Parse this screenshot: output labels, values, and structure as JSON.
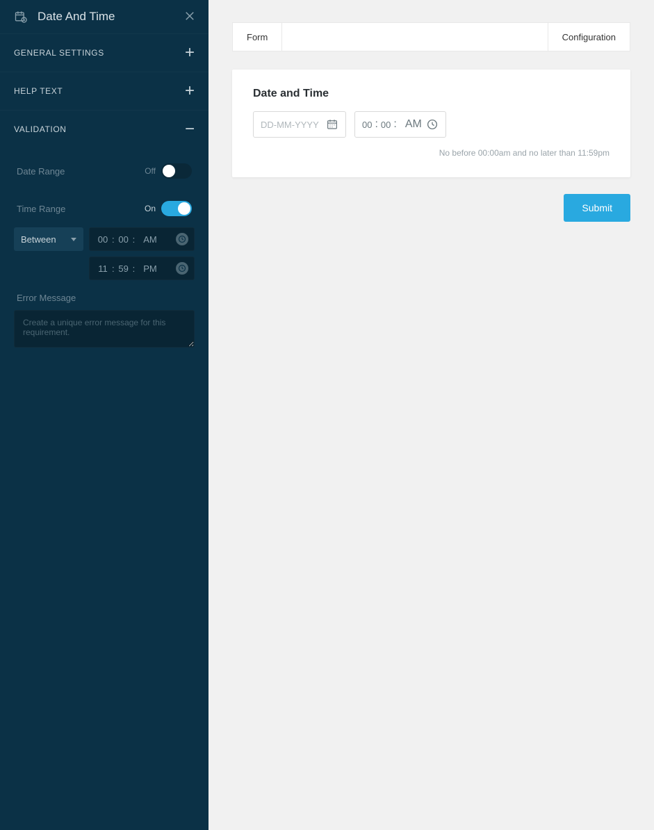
{
  "sidebar": {
    "title": "Date And Time",
    "sections": {
      "general": {
        "title": "GENERAL SETTINGS",
        "expanded": false
      },
      "help": {
        "title": "HELP TEXT",
        "expanded": false
      },
      "validation": {
        "title": "VALIDATION",
        "expanded": true
      }
    },
    "dateRange": {
      "label": "Date Range",
      "state": "Off",
      "on": false
    },
    "timeRange": {
      "label": "Time Range",
      "state": "On",
      "on": true,
      "mode": "Between",
      "from": {
        "hh": "00",
        "mm": "00",
        "ampm": "AM"
      },
      "to": {
        "hh": "11",
        "mm": "59",
        "ampm": "PM"
      }
    },
    "errorMessage": {
      "label": "Error Message",
      "placeholder": "Create a unique error message for this requirement."
    }
  },
  "main": {
    "tabs": {
      "form": "Form",
      "config": "Configuration"
    },
    "card": {
      "title": "Date and Time",
      "datePlaceholder": "DD-MM-YYYY",
      "time": {
        "hh": "00",
        "mm": "00",
        "ampm": "AM"
      },
      "hint": "No before 00:00am and no later than 11:59pm"
    },
    "submit": "Submit"
  }
}
